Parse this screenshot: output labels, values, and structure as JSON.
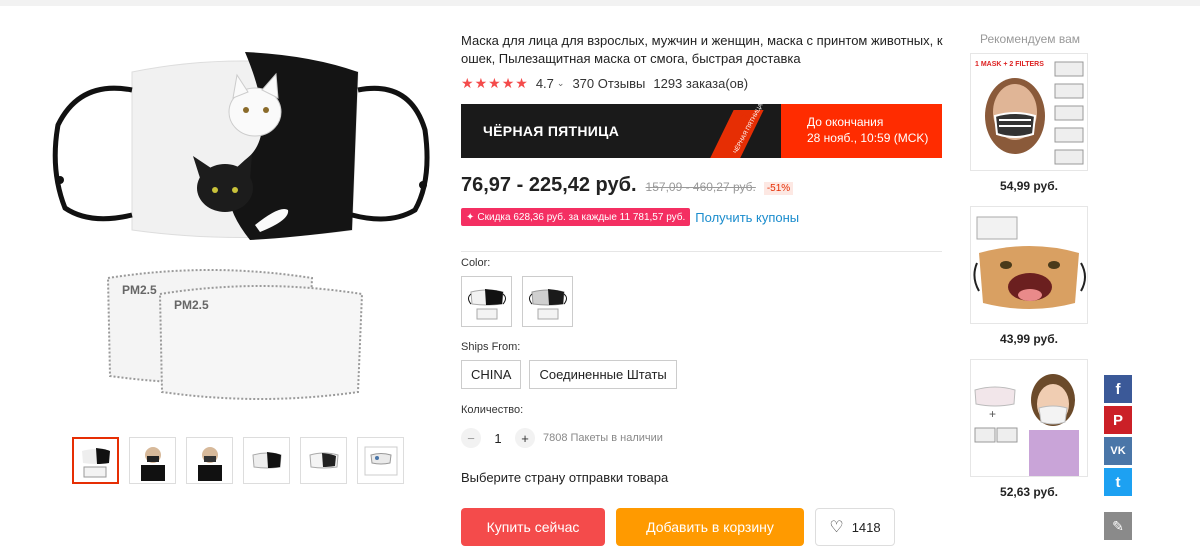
{
  "product": {
    "title": "Маска для лица для взрослых, мужчин и женщин, маска с принтом животных, к ошек, Пылезащитная маска от смога, быстрая доставка",
    "rating": "4.7",
    "reviews": "370 Отзывы",
    "orders": "1293 заказа(ов)",
    "stars_filled": 5
  },
  "promo": {
    "title": "ЧЁРНАЯ ПЯТНИЦА",
    "ribbon_text": "ЧЁРНАЯ ПЯТНИЦА",
    "until_label": "До окончания",
    "until_date": "28 нояб., 10:59 (MCK)"
  },
  "price": {
    "current": "76,97 - 225,42 руб.",
    "old": "157,09 - 460,27 руб.",
    "discount": "-51%"
  },
  "coupon": {
    "text": "Скидка 628,36 руб. за каждые 11 781,57 руб.",
    "link": "Получить купоны"
  },
  "color": {
    "label": "Color:",
    "options": [
      "cat-print-white-black",
      "cat-print-gray-black"
    ]
  },
  "shipping": {
    "label": "Ships From:",
    "options": [
      "CHINA",
      "Соединенные Штаты"
    ]
  },
  "quantity": {
    "label": "Количество:",
    "minus": "−",
    "value": "1",
    "plus": "+",
    "stock": "7808 Пакеты в наличии"
  },
  "country_prompt": "Выберите страну отправки товара",
  "actions": {
    "buy": "Купить сейчас",
    "cart": "Добавить в корзину",
    "wishlist_count": "1418"
  },
  "gallery": {
    "filter_label": "PM2.5"
  },
  "recommendations": {
    "title": "Рекомендуем вам",
    "items": [
      {
        "price": "54,99 руб.",
        "banner": "1 MASK + 2 FILTERS"
      },
      {
        "price": "43,99 руб."
      },
      {
        "price": "52,63 руб."
      }
    ]
  },
  "social": {
    "facebook": "f",
    "pinterest": "P",
    "vk": "VK",
    "twitter": "t",
    "edit": "✎"
  },
  "colors": {
    "accent_red": "#f44b4b",
    "promo_red": "#ff2c00",
    "orange": "#ff9a00",
    "coupon_pink": "#f42f62",
    "link_blue": "#1a8ccd"
  }
}
